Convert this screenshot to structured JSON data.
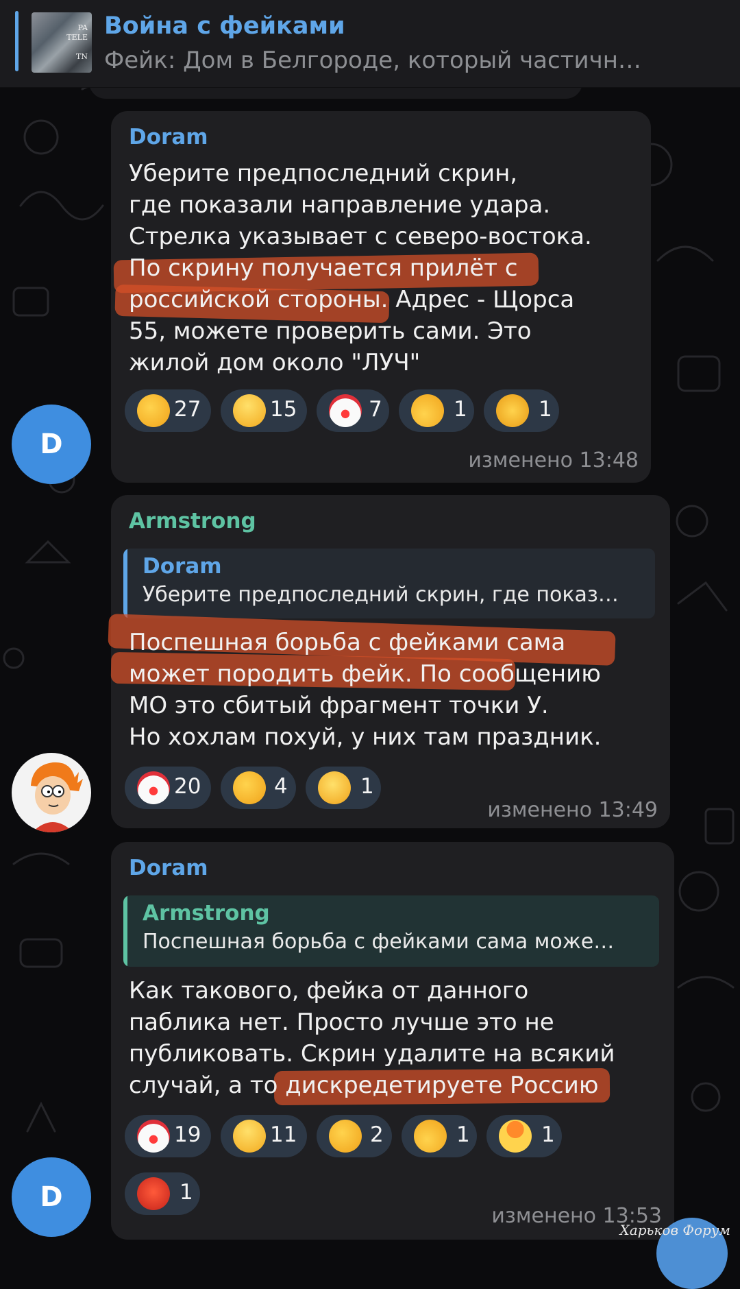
{
  "pinned": {
    "title": "Война с фейками",
    "subtitle": "Фейк: Дом в Белгороде, который частичн…",
    "thumb_text": "PA\nTELE\n\nTN"
  },
  "messages": [
    {
      "author": "Doram",
      "author_color": "#5fa6e8",
      "avatar": "D",
      "text": "Уберите предпоследний скрин,\nгде показали направление удара.\nСтрелка указывает с северо-востока.\nПо скрину получается прилёт с\nроссийской стороны. Адрес - Щорса\n55, можете проверить сами. Это\nжилой дом около \"ЛУЧ\"",
      "reactions": [
        {
          "emoji": "thumbs-up",
          "count": "27"
        },
        {
          "emoji": "grinning-face",
          "count": "15"
        },
        {
          "emoji": "clown-face",
          "count": "7"
        },
        {
          "emoji": "thumbs-down",
          "count": "1"
        },
        {
          "emoji": "clapping-hands",
          "count": "1"
        }
      ],
      "edited": "изменено 13:48"
    },
    {
      "author": "Armstrong",
      "author_color": "#5ec3a3",
      "avatar": "fry",
      "reply": {
        "author": "Doram",
        "text": "Уберите предпоследний скрин, где показ…"
      },
      "text": "Поспешная борьба с фейками сама\nможет породить фейк. По сообщению\nМО это сбитый фрагмент точки У.\nНо хохлам похуй, у них там праздник.",
      "reactions": [
        {
          "emoji": "clown-face",
          "count": "20"
        },
        {
          "emoji": "thumbs-up",
          "count": "4"
        },
        {
          "emoji": "raised-eyebrow-face",
          "count": "1"
        }
      ],
      "edited": "изменено 13:49"
    },
    {
      "author": "Doram",
      "author_color": "#5fa6e8",
      "avatar": "D",
      "reply": {
        "author": "Armstrong",
        "text": "Поспешная борьба с фейками сама може…"
      },
      "text": "Как такового, фейка от данного\nпаблика нет. Просто лучше это не\nпубликовать. Скрин удалите на всякий\nслучай, а то дискредетируете Россию",
      "reactions": [
        {
          "emoji": "clown-face",
          "count": "19"
        },
        {
          "emoji": "grinning-face",
          "count": "11"
        },
        {
          "emoji": "thumbs-up",
          "count": "2"
        },
        {
          "emoji": "thumbs-down",
          "count": "1"
        },
        {
          "emoji": "exploding-head",
          "count": "1"
        },
        {
          "emoji": "swearing-face",
          "count": "1"
        }
      ],
      "edited": "изменено 13:53"
    }
  ],
  "watermark": "Харьков Форум",
  "colors": {
    "accent": "#5fa6e8",
    "armstrong": "#5ec3a3",
    "bubble": "#1f1f22",
    "reaction_bg": "#2d3846",
    "highlight": "#d75028"
  }
}
